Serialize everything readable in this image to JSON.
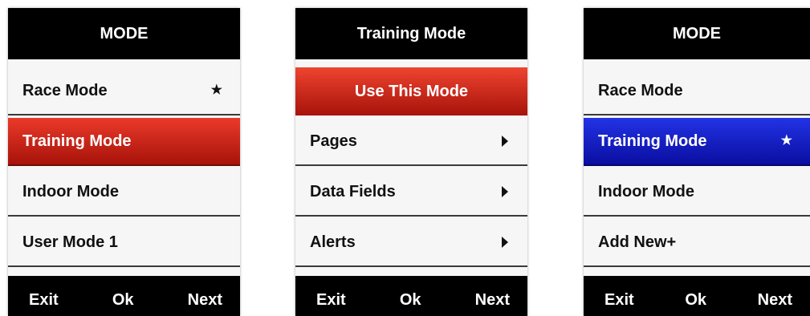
{
  "screens": [
    {
      "title": "MODE",
      "items": [
        "Race Mode",
        "Training Mode",
        "Indoor Mode",
        "User Mode 1"
      ],
      "selected_item": "Training Mode",
      "starred_item": "Race Mode",
      "footer": {
        "exit": "Exit",
        "ok": "Ok",
        "next": "Next"
      },
      "highlight_color": "#c91c10"
    },
    {
      "title": "Training Mode",
      "primary_action": "Use This Mode",
      "items": [
        "Pages",
        "Data Fields",
        "Alerts"
      ],
      "footer": {
        "exit": "Exit",
        "ok": "Ok",
        "next": "Next"
      },
      "highlight_color": "#c91c10"
    },
    {
      "title": "MODE",
      "items": [
        "Race Mode",
        "Training Mode",
        "Indoor Mode",
        "Add New+"
      ],
      "selected_item": "Training Mode",
      "starred_item": "Training Mode",
      "footer": {
        "exit": "Exit",
        "ok": "Ok",
        "next": "Next"
      },
      "highlight_color": "#1622c8"
    }
  ],
  "icons": {
    "star": "★",
    "submenu_arrow": "triangle-right"
  }
}
